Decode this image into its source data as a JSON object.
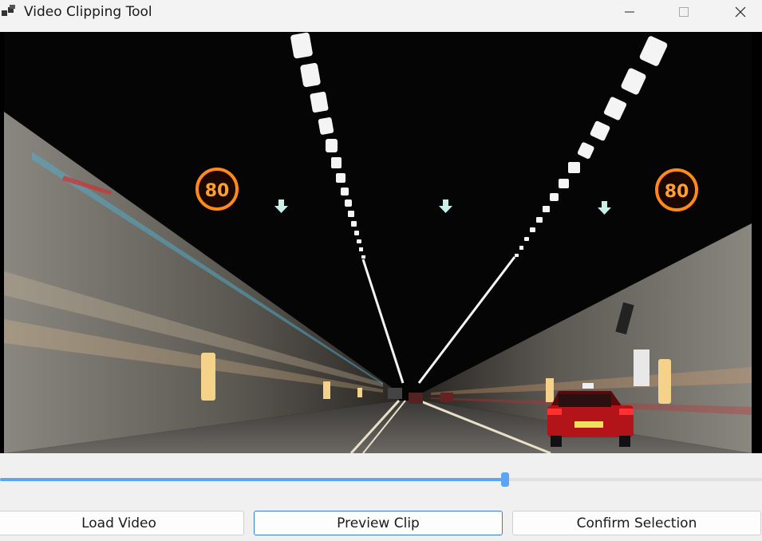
{
  "window": {
    "title": "Video Clipping Tool",
    "icons": {
      "app": "app-icon",
      "minimize": "minimize-icon",
      "maximize": "maximize-icon",
      "close": "close-icon"
    }
  },
  "video": {
    "speed_sign_left": "80",
    "speed_sign_right": "80"
  },
  "timeline": {
    "position_fraction": 0.663,
    "accent_color": "#5aa6f5"
  },
  "buttons": {
    "load": "Load Video",
    "preview": "Preview Clip",
    "confirm": "Confirm Selection"
  }
}
